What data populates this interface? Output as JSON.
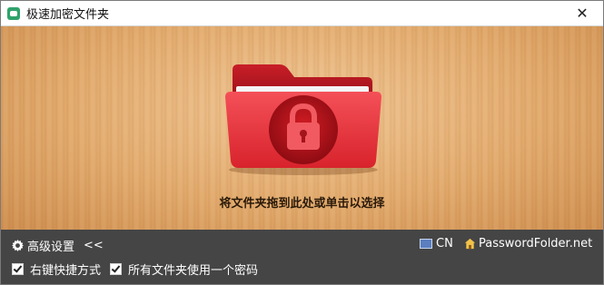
{
  "window": {
    "title": "极速加密文件夹",
    "close_glyph": "✕"
  },
  "drop_area": {
    "hint": "将文件夹拖到此处或单击以选择"
  },
  "bottom_bar": {
    "advanced_label": "高级设置",
    "advanced_toggle": "<<",
    "language": "CN",
    "website": "PasswordFolder.net",
    "options": [
      {
        "label": "右键快捷方式",
        "checked": true
      },
      {
        "label": "所有文件夹使用一个密码",
        "checked": true
      }
    ]
  },
  "icons": {
    "app": "app-lock-icon",
    "folder": "locked-folder-icon",
    "settings": "gear-icon",
    "language": "flag-icon",
    "website": "home-icon"
  },
  "colors": {
    "titlebar_bg": "#ffffff",
    "wood_light": "#f0c694",
    "wood_dark": "#cf8f4f",
    "folder_red": "#e8323a",
    "bottom_bg": "#454545"
  }
}
